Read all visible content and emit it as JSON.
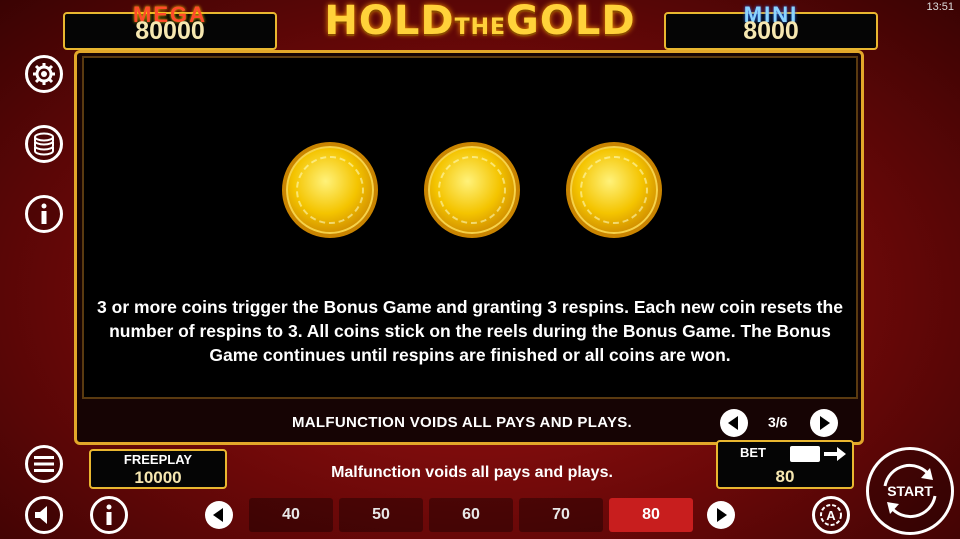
{
  "status_bar": {
    "time": "13:51"
  },
  "header": {
    "mega_label": "MEGA",
    "mega_value": "80000",
    "title_main": "HOLD",
    "title_the": "THE",
    "title_end": "GOLD",
    "mini_label": "MINI",
    "mini_value": "8000"
  },
  "info_panel": {
    "coin_count": 3,
    "description": "3 or more coins trigger the Bonus Game and granting 3 respins. Each new coin resets the number of respins to 3. All coins stick on the reels during the Bonus Game. The Bonus Game continues until respins are finished or all coins are won.",
    "malfunction_text": "MALFUNCTION VOIDS ALL PAYS AND PLAYS.",
    "page_indicator": "3/6"
  },
  "left_controls": {
    "icons": [
      "gear-icon",
      "coins-stack-icon",
      "info-icon",
      "menu-icon",
      "sound-icon",
      "info-icon"
    ]
  },
  "footer": {
    "freeplay_label": "FREEPLAY",
    "freeplay_value": "10000",
    "message": "Malfunction voids all pays and plays.",
    "bet_label": "BET",
    "bet_value": "80",
    "bet_options": [
      "40",
      "50",
      "60",
      "70",
      "80"
    ],
    "selected_bet": "80",
    "start_label": "START"
  },
  "colors": {
    "accent_gold": "#e9b730",
    "selected_red": "#c81e1e",
    "panel_black": "#000000"
  }
}
